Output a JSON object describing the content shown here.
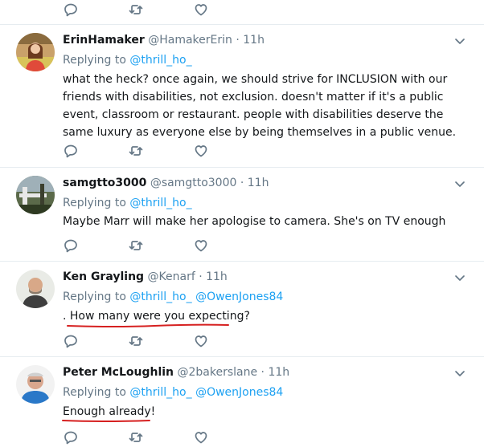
{
  "tweets": [
    {
      "name": "ErinHamaker",
      "handle": "@HamakerErin",
      "sep": "·",
      "time": "11h",
      "replying_prefix": "Replying to",
      "mentions": [
        "@thrill_ho_"
      ],
      "text": "what the heck? once again, we should strive for INCLUSION with our friends with disabilities, not exclusion. doesn't matter if it's a public event, classroom or restaurant. people with disabilities deserve the same luxury as everyone else by being themselves in a public venue."
    },
    {
      "name": "samgtto3000",
      "handle": "@samgtto3000",
      "sep": "·",
      "time": "11h",
      "replying_prefix": "Replying to",
      "mentions": [
        "@thrill_ho_"
      ],
      "text": "Maybe Marr will make her apologise to camera. She's on TV enough"
    },
    {
      "name": "Ken Grayling",
      "handle": "@Kenarf",
      "sep": "·",
      "time": "11h",
      "replying_prefix": "Replying to",
      "mentions": [
        "@thrill_ho_",
        "@OwenJones84"
      ],
      "text": ". How many were you expecting?"
    },
    {
      "name": "Peter McLoughlin",
      "handle": "@2bakerslane",
      "sep": "·",
      "time": "11h",
      "replying_prefix": "Replying to",
      "mentions": [
        "@thrill_ho_",
        "@OwenJones84"
      ],
      "text": "Enough already!"
    }
  ],
  "icons": {
    "reply": "reply-icon",
    "retweet": "retweet-icon",
    "like": "like-icon",
    "more": "chevron-down-icon"
  },
  "colors": {
    "link": "#1da1f2",
    "muted": "#657786",
    "divider": "#e6ecf0",
    "annotation": "#d62020"
  }
}
